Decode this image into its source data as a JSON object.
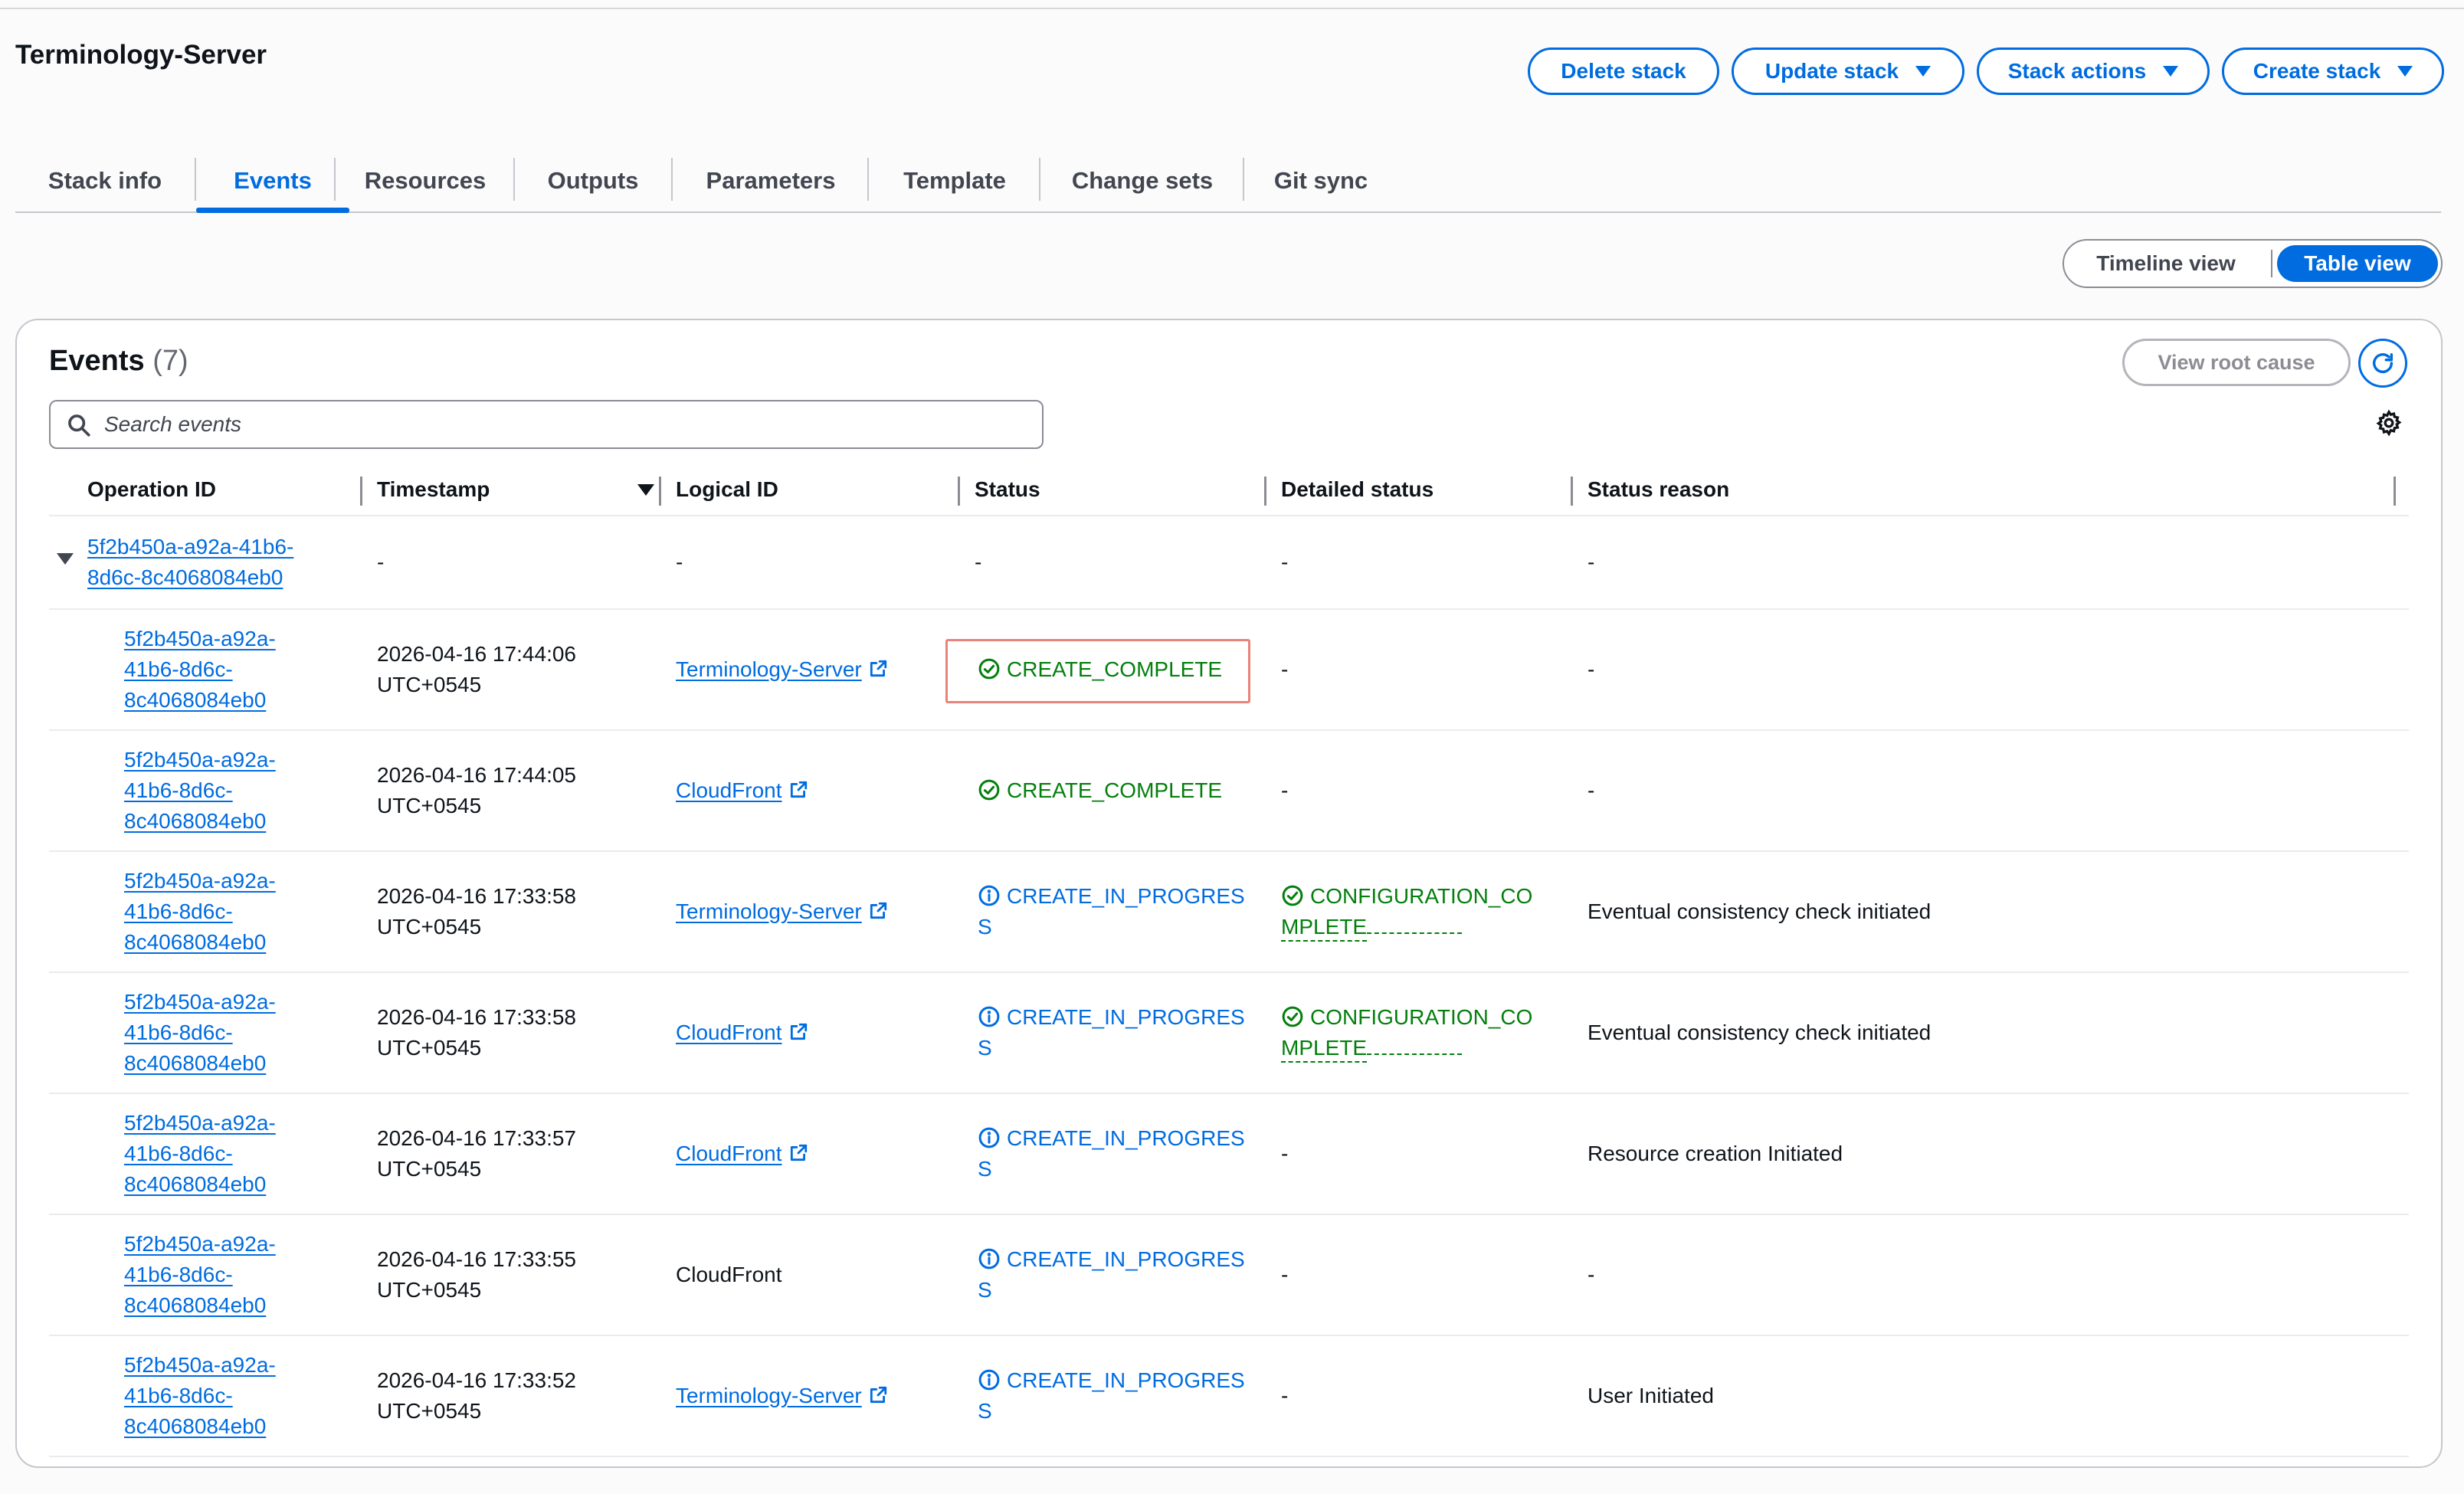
{
  "stack": {
    "name": "Terminology-Server"
  },
  "actions": {
    "delete": "Delete stack",
    "update": "Update stack",
    "stack_actions": "Stack actions",
    "create": "Create stack"
  },
  "tabs": [
    "Stack info",
    "Events",
    "Resources",
    "Outputs",
    "Parameters",
    "Template",
    "Change sets",
    "Git sync"
  ],
  "active_tab": "Events",
  "view_toggle": {
    "timeline": "Timeline view",
    "table": "Table view",
    "selected": "Table view"
  },
  "events_panel": {
    "title": "Events",
    "count": "(7)",
    "view_root_cause": "View root cause",
    "search_placeholder": "Search events",
    "columns": [
      "Operation ID",
      "Timestamp",
      "Logical ID",
      "Status",
      "Detailed status",
      "Status reason"
    ],
    "sort_column": "Timestamp"
  },
  "group_row": {
    "operation_id_line1": "5f2b450a-a92a-41b6-",
    "operation_id_line2": "8d6c-8c4068084eb0",
    "timestamp": "-",
    "logical_id": "-",
    "status": "-",
    "detailed_status": "-",
    "status_reason": "-"
  },
  "events": [
    {
      "op1": "5f2b450a-a92a-",
      "op2": "41b6-8d6c-",
      "op3": "8c4068084eb0",
      "ts1": "2026-04-16 17:44:06",
      "ts2": "UTC+0545",
      "logical_id": "Terminology-Server",
      "logical_link": true,
      "status1": "CREATE_COMPLETE",
      "status2": "",
      "status_type": "success",
      "detail1": "-",
      "detail2": "",
      "detail_type": "none",
      "reason": "-",
      "highlighted": true
    },
    {
      "op1": "5f2b450a-a92a-",
      "op2": "41b6-8d6c-",
      "op3": "8c4068084eb0",
      "ts1": "2026-04-16 17:44:05",
      "ts2": "UTC+0545",
      "logical_id": "CloudFront",
      "logical_link": true,
      "status1": "CREATE_COMPLETE",
      "status2": "",
      "status_type": "success",
      "detail1": "-",
      "detail2": "",
      "detail_type": "none",
      "reason": "-",
      "highlighted": false
    },
    {
      "op1": "5f2b450a-a92a-",
      "op2": "41b6-8d6c-",
      "op3": "8c4068084eb0",
      "ts1": "2026-04-16 17:33:58",
      "ts2": "UTC+0545",
      "logical_id": "Terminology-Server",
      "logical_link": true,
      "status1": "CREATE_IN_PROGRES",
      "status2": "S",
      "status_type": "info",
      "detail1": "CONFIGURATION_CO",
      "detail2": "MPLETE",
      "detail_type": "success",
      "reason": "Eventual consistency check initiated",
      "highlighted": false
    },
    {
      "op1": "5f2b450a-a92a-",
      "op2": "41b6-8d6c-",
      "op3": "8c4068084eb0",
      "ts1": "2026-04-16 17:33:58",
      "ts2": "UTC+0545",
      "logical_id": "CloudFront",
      "logical_link": true,
      "status1": "CREATE_IN_PROGRES",
      "status2": "S",
      "status_type": "info",
      "detail1": "CONFIGURATION_CO",
      "detail2": "MPLETE",
      "detail_type": "success",
      "reason": "Eventual consistency check initiated",
      "highlighted": false
    },
    {
      "op1": "5f2b450a-a92a-",
      "op2": "41b6-8d6c-",
      "op3": "8c4068084eb0",
      "ts1": "2026-04-16 17:33:57",
      "ts2": "UTC+0545",
      "logical_id": "CloudFront",
      "logical_link": true,
      "status1": "CREATE_IN_PROGRES",
      "status2": "S",
      "status_type": "info",
      "detail1": "-",
      "detail2": "",
      "detail_type": "none",
      "reason": "Resource creation Initiated",
      "highlighted": false
    },
    {
      "op1": "5f2b450a-a92a-",
      "op2": "41b6-8d6c-",
      "op3": "8c4068084eb0",
      "ts1": "2026-04-16 17:33:55",
      "ts2": "UTC+0545",
      "logical_id": "CloudFront",
      "logical_link": false,
      "status1": "CREATE_IN_PROGRES",
      "status2": "S",
      "status_type": "info",
      "detail1": "-",
      "detail2": "",
      "detail_type": "none",
      "reason": "-",
      "highlighted": false
    },
    {
      "op1": "5f2b450a-a92a-",
      "op2": "41b6-8d6c-",
      "op3": "8c4068084eb0",
      "ts1": "2026-04-16 17:33:52",
      "ts2": "UTC+0545",
      "logical_id": "Terminology-Server",
      "logical_link": true,
      "status1": "CREATE_IN_PROGRES",
      "status2": "S",
      "status_type": "info",
      "detail1": "-",
      "detail2": "",
      "detail_type": "none",
      "reason": "User Initiated",
      "highlighted": false
    }
  ],
  "colors": {
    "accent": "#006ce0",
    "success": "#037f0c",
    "highlight_border": "#e8837a",
    "text": "#0f141a"
  }
}
